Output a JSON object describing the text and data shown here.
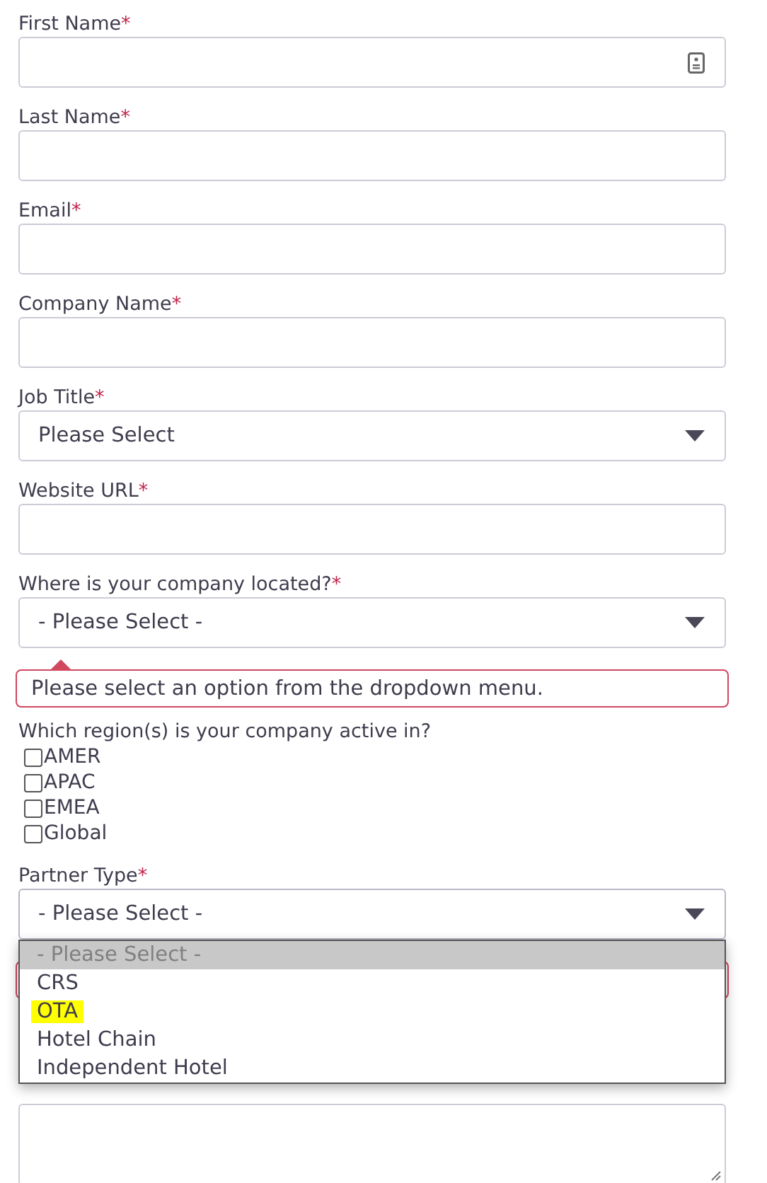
{
  "fields": [
    {
      "kind": "text",
      "label": "First Name",
      "required_mark": "*",
      "autofill": true
    },
    {
      "kind": "text",
      "label": "Last Name",
      "required_mark": "*",
      "autofill": false
    },
    {
      "kind": "text",
      "label": "Email",
      "required_mark": "*",
      "autofill": false
    },
    {
      "kind": "text",
      "label": "Company Name",
      "required_mark": "*",
      "autofill": false
    },
    {
      "kind": "select",
      "label": "Job Title",
      "required_mark": "*",
      "value": "Please Select",
      "invalid": false,
      "expanded": false
    },
    {
      "kind": "text",
      "label": "Website URL",
      "required_mark": "*",
      "autofill": false
    },
    {
      "kind": "select",
      "label": "Where is your company located?",
      "required_mark": "*",
      "value": "- Please Select -",
      "invalid": true,
      "error": "Please select an option from the dropdown menu.",
      "expanded": false
    },
    {
      "kind": "checkboxes",
      "label": "Which region(s) is your company active in?",
      "options": [
        {
          "label": "AMER",
          "checked": false
        },
        {
          "label": "APAC",
          "checked": false
        },
        {
          "label": "EMEA",
          "checked": false
        },
        {
          "label": "Global",
          "checked": false
        }
      ]
    },
    {
      "kind": "select",
      "label": "Partner Type",
      "required_mark": "*",
      "value": "- Please Select -",
      "invalid": true,
      "expanded": true,
      "options": [
        {
          "label": "- Please Select -",
          "selected": true,
          "highlighted": false
        },
        {
          "label": "CRS",
          "selected": false,
          "highlighted": false
        },
        {
          "label": "OTA",
          "selected": false,
          "highlighted": true
        },
        {
          "label": "Hotel Chain",
          "selected": false,
          "highlighted": false
        },
        {
          "label": "Independent Hotel",
          "selected": false,
          "highlighted": false
        }
      ]
    },
    {
      "kind": "textarea"
    }
  ]
}
